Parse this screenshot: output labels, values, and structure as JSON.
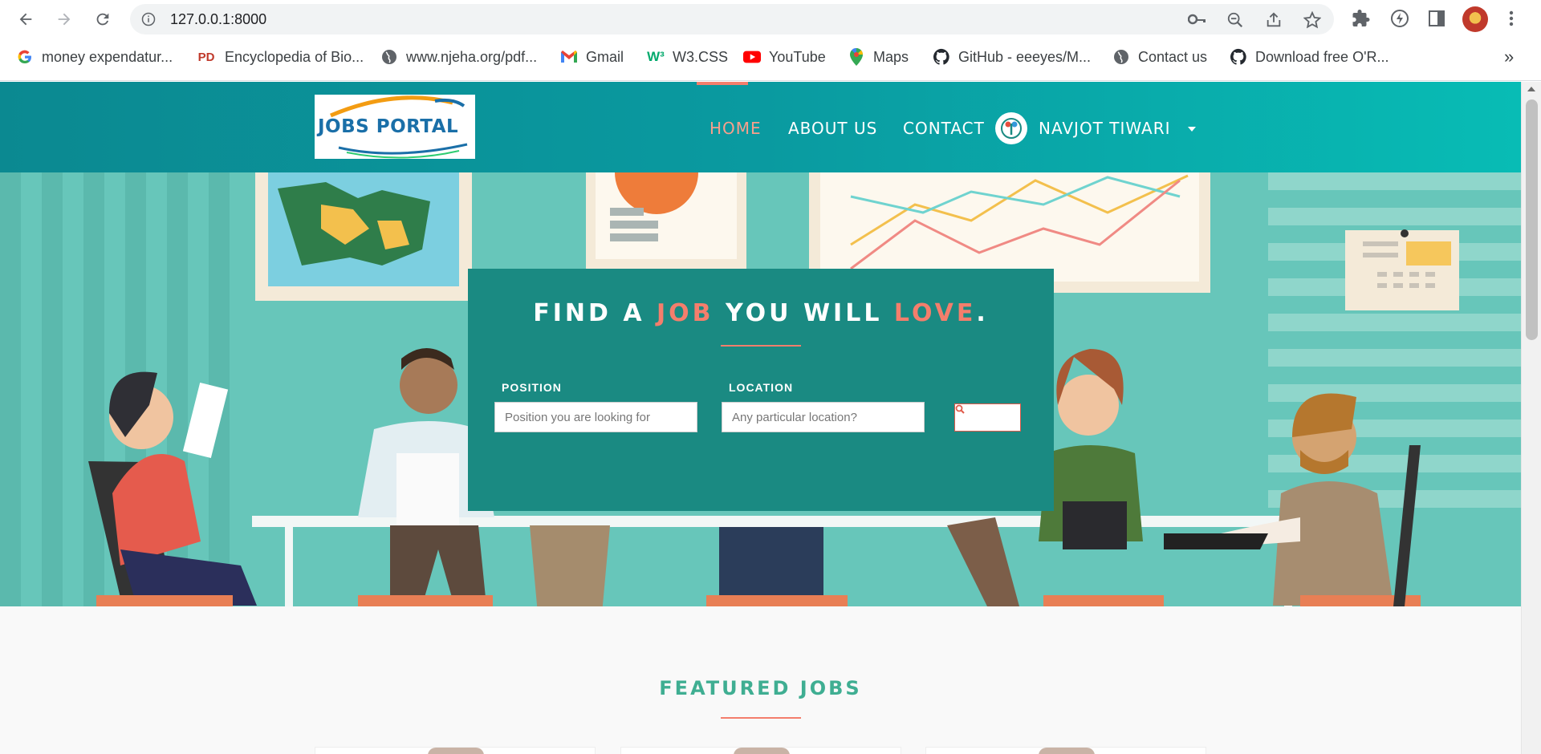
{
  "browser": {
    "url": "127.0.0.1:8000",
    "icons": [
      "back-icon",
      "forward-icon",
      "reload-icon",
      "site-info-icon",
      "key-icon",
      "zoom-out-icon",
      "share-icon",
      "star-icon",
      "extensions-icon",
      "lightning-icon",
      "side-panel-icon",
      "profile-avatar",
      "menu-icon"
    ]
  },
  "bookmarks": {
    "items": [
      {
        "label": "money expendatur...",
        "icon": "google-icon"
      },
      {
        "label": "Encyclopedia of Bio...",
        "icon": "pd-icon"
      },
      {
        "label": "www.njeha.org/pdf...",
        "icon": "globe-icon"
      },
      {
        "label": "Gmail",
        "icon": "gmail-icon"
      },
      {
        "label": "W3.CSS",
        "icon": "w3-icon"
      },
      {
        "label": "YouTube",
        "icon": "youtube-icon"
      },
      {
        "label": "Maps",
        "icon": "maps-icon"
      },
      {
        "label": "GitHub - eeeyes/M...",
        "icon": "github-icon"
      },
      {
        "label": "Contact us",
        "icon": "globe-icon"
      },
      {
        "label": "Download free O'R...",
        "icon": "github-icon"
      }
    ],
    "more": "»"
  },
  "site": {
    "logo_text": "JOBS PORTAL",
    "nav": {
      "home": "HOME",
      "about": "ABOUT US",
      "contact": "CONTACT",
      "user": "NAVJOT TIWARI"
    },
    "colors": {
      "header": "#0a9aa0",
      "accent": "#f47e6c",
      "panel": "#1a8a82",
      "featured": "#3fae92"
    }
  },
  "hero": {
    "title_parts": [
      "FIND A ",
      "JOB",
      " YOU WILL ",
      "LOVE",
      "."
    ],
    "position_label": "POSITION",
    "position_placeholder": "Position you are looking for",
    "location_label": "LOCATION",
    "location_placeholder": "Any particular location?",
    "search_icon": "search-icon"
  },
  "featured": {
    "title": "FEATURED JOBS"
  }
}
